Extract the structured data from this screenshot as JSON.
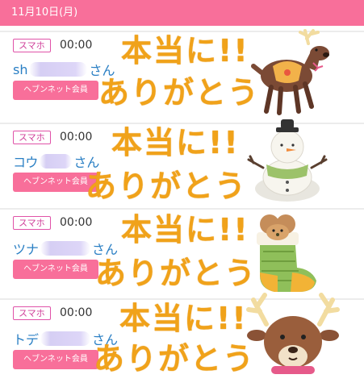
{
  "date_header": "11月10日(月)",
  "badge_label": "スマホ",
  "member_label": "ヘブンネット会員",
  "honorific": "さん",
  "thanks_line1": "本当に!!",
  "thanks_line2": "ありがとう",
  "entries": [
    {
      "time": "00:00",
      "name_prefix": "sh",
      "illustration": "reindeer-icon"
    },
    {
      "time": "00:00",
      "name_prefix": "コウ",
      "illustration": "snowman-icon"
    },
    {
      "time": "00:00",
      "name_prefix": "ツナ",
      "illustration": "stocking-icon"
    },
    {
      "time": "00:00",
      "name_prefix": "トデ",
      "illustration": "reindeer-face-icon"
    }
  ]
}
